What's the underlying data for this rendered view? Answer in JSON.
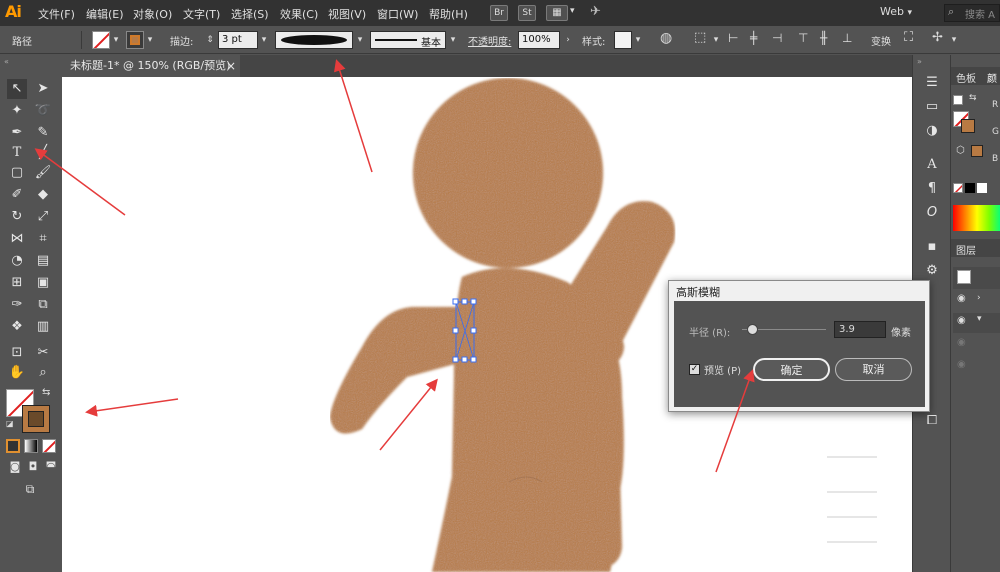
{
  "app": {
    "logo": "Ai"
  },
  "menu": [
    "文件(F)",
    "编辑(E)",
    "对象(O)",
    "文字(T)",
    "选择(S)",
    "效果(C)",
    "视图(V)",
    "窗口(W)",
    "帮助(H)"
  ],
  "menubar_icons": {
    "br": "Br",
    "st": "St"
  },
  "workspace": "Web",
  "search_placeholder": "搜索 A",
  "control": {
    "object_type": "路径",
    "stroke_label": "描边:",
    "stroke_weight": "3 pt",
    "brush_label": "基本",
    "opacity_label": "不透明度:",
    "opacity_value": "100%",
    "style_label": "样式:",
    "transform_label": "变换"
  },
  "document_tab": {
    "title": "未标题-1* @ 150% (RGB/预览)",
    "close": "×"
  },
  "right_panel": {
    "tab1": "色板",
    "tab2": "颜",
    "layers_tab": "图层",
    "letters": [
      "R",
      "G",
      "B"
    ]
  },
  "dialog": {
    "title": "高斯模糊",
    "radius_label": "半径 (R):",
    "radius_value": "3.9",
    "unit": "像素",
    "preview_label": "预览 (P)",
    "ok_label": "确定",
    "cancel_label": "取消",
    "preview_checked": true,
    "slider_fraction": 0.12
  },
  "colors": {
    "accent": "#ff9a00",
    "fill": "#b87a43",
    "arrow": "#e53c3c",
    "ui_dark": "#323232",
    "ui_panel": "#535353"
  }
}
